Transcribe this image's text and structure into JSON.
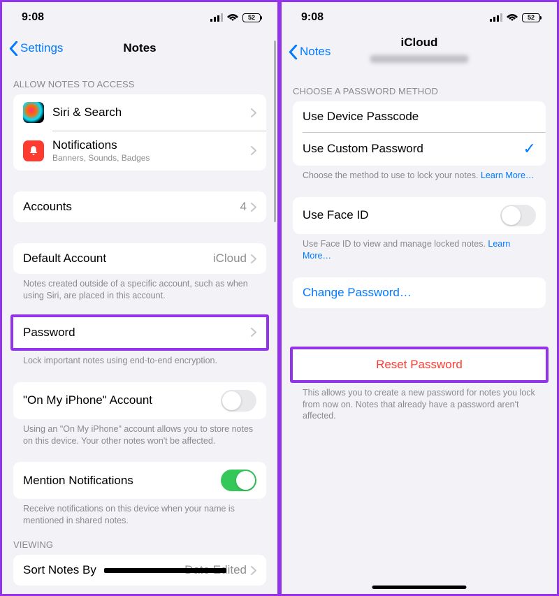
{
  "status": {
    "time": "9:08",
    "battery": "52"
  },
  "left": {
    "back": "Settings",
    "title": "Notes",
    "section_access": "ALLOW NOTES TO ACCESS",
    "siri": "Siri & Search",
    "notifications": {
      "label": "Notifications",
      "sub": "Banners, Sounds, Badges"
    },
    "accounts": {
      "label": "Accounts",
      "value": "4"
    },
    "default_account": {
      "label": "Default Account",
      "value": "iCloud"
    },
    "default_footer": "Notes created outside of a specific account, such as when using Siri, are placed in this account.",
    "password": {
      "label": "Password",
      "footer": "Lock important notes using end-to-end encryption."
    },
    "onmyiphone": {
      "label": "\"On My iPhone\" Account",
      "footer": "Using an \"On My iPhone\" account allows you to store notes on this device. Your other notes won't be affected."
    },
    "mention": {
      "label": "Mention Notifications",
      "footer": "Receive notifications on this device when your name is mentioned in shared notes."
    },
    "viewing_header": "VIEWING",
    "sort": {
      "label": "Sort Notes By",
      "value": "Date Edited"
    }
  },
  "right": {
    "back": "Notes",
    "title": "iCloud",
    "method_header": "CHOOSE A PASSWORD METHOD",
    "device_passcode": "Use Device Passcode",
    "custom_password": "Use Custom Password",
    "method_footer": "Choose the method to use to lock your notes. ",
    "learn_more": "Learn More…",
    "faceid": {
      "label": "Use Face ID",
      "footer": "Use Face ID to view and manage locked notes. "
    },
    "change_password": "Change Password…",
    "reset_password": "Reset Password",
    "reset_footer": "This allows you to create a new password for notes you lock from now on. Notes that already have a password aren't affected."
  }
}
